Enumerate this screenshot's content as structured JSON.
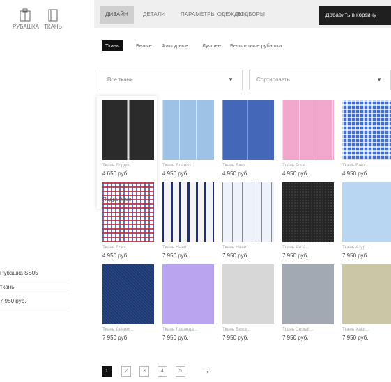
{
  "sidebar": {
    "icons": [
      {
        "label": "РУБАШКА",
        "icon": "shirt-icon"
      },
      {
        "label": "ТКАНЬ",
        "icon": "fabric-icon"
      }
    ],
    "summary_rows": [
      {
        "text": "Рубашка SS05"
      },
      {
        "text": "ткань"
      },
      {
        "text": "7 950 руб."
      }
    ]
  },
  "tabs": {
    "items": [
      {
        "label": "ДИЗАЙН"
      },
      {
        "label": "ДЕТАЛИ"
      },
      {
        "label": "ПАРАМЕТРЫ ОДЕЖДЫ"
      },
      {
        "label": "ПОДБОРЫ"
      }
    ],
    "cart_button": "Добавить в корзину"
  },
  "subtabs": [
    "Ткань",
    "Белые",
    "Фактурные",
    "Лучшее",
    "Бесплатные рубашки"
  ],
  "filters": {
    "left": "Все ткани",
    "right": "Сортировать"
  },
  "fabrics": [
    {
      "caption": "Ткань Бордо...",
      "price": "4 650 руб.",
      "color": "#2b2b2b",
      "pattern": "stripe-dark"
    },
    {
      "caption": "Ткань Бланко...",
      "price": "4 950 руб.",
      "color": "#9ec1e6",
      "pattern": "stripe-light"
    },
    {
      "caption": "Ткань Блю...",
      "price": "4 950 руб.",
      "color": "#4567b8",
      "pattern": "solid-dark"
    },
    {
      "caption": "Ткань Роза...",
      "price": "4 950 руб.",
      "color": "#f2a7cc",
      "pattern": "stripe-light"
    },
    {
      "caption": "Ткань Блю...",
      "price": "4 950 руб.",
      "color": "#3f6fd6",
      "pattern": "check"
    },
    {
      "caption": "Ткань Блю...",
      "price": "4 950 руб.",
      "color": "#c12b3a",
      "pattern": "check-red"
    },
    {
      "caption": "Ткань Нави...",
      "price": "7 950 руб.",
      "color": "#1e2f7a",
      "pattern": "stripe-navy"
    },
    {
      "caption": "Ткань Нави...",
      "price": "7 950 руб.",
      "color": "#6a89d6",
      "pattern": "stripe-thin"
    },
    {
      "caption": "Ткань Анта...",
      "price": "7 950 руб.",
      "color": "#262626",
      "pattern": "texture-dark"
    },
    {
      "caption": "Ткань Азур...",
      "price": "7 950 руб.",
      "color": "#b8d6f2",
      "pattern": "solid-light"
    },
    {
      "caption": "Ткань Деним...",
      "price": "7 950 руб.",
      "color": "#1d3a75",
      "pattern": "denim"
    },
    {
      "caption": "Ткань Лаванда...",
      "price": "7 950 руб.",
      "color": "#b9a5ef",
      "pattern": "solid-light"
    },
    {
      "caption": "Ткань Бежа...",
      "price": "7 950 руб.",
      "color": "#d7d7d7",
      "pattern": "solid-light"
    },
    {
      "caption": "Ткань Серый...",
      "price": "7 950 руб.",
      "color": "#a2a9b2",
      "pattern": "solid-light"
    },
    {
      "caption": "Ткань Хаки...",
      "price": "7 950 руб.",
      "color": "#c9c7a6",
      "pattern": "solid-light"
    }
  ],
  "selected": {
    "caption": "Ткань Бордо...",
    "price": "4 650 руб.",
    "more_label": "Подробнее"
  },
  "pagination": {
    "pages": [
      "1",
      "2",
      "3",
      "4",
      "5"
    ],
    "current": "1",
    "next": "→"
  }
}
